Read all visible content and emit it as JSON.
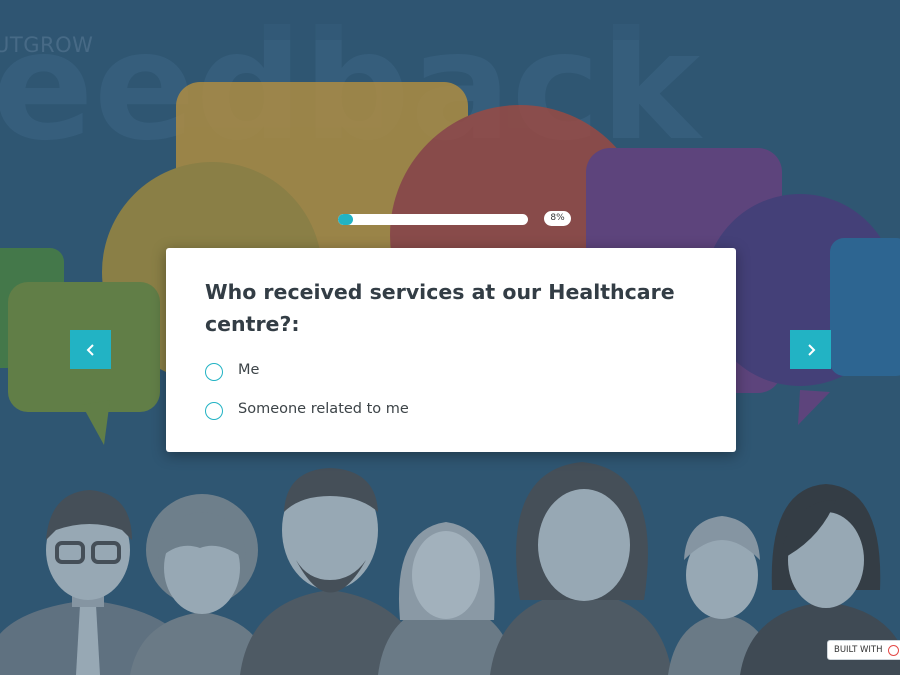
{
  "background": {
    "brand_text": "UTGROW",
    "hero_word": "eedback"
  },
  "progress": {
    "fraction": 0.08,
    "label": "8%"
  },
  "question": {
    "text": "Who received services at our Healthcare centre?:",
    "options": [
      {
        "label": "Me"
      },
      {
        "label": "Someone related to me"
      }
    ]
  },
  "navigation": {
    "prev_icon": "chevron-left-icon",
    "next_icon": "chevron-right-icon"
  },
  "footer": {
    "badge_label": "BUILT WITH"
  },
  "colors": {
    "background": "#2f5672",
    "accent": "#22b3c4",
    "bubble_yellow": "#b8913d",
    "bubble_red": "#a2493f",
    "bubble_purple": "#6b3f7f",
    "bubble_green": "#4b8240",
    "people": "#97a8b4"
  }
}
